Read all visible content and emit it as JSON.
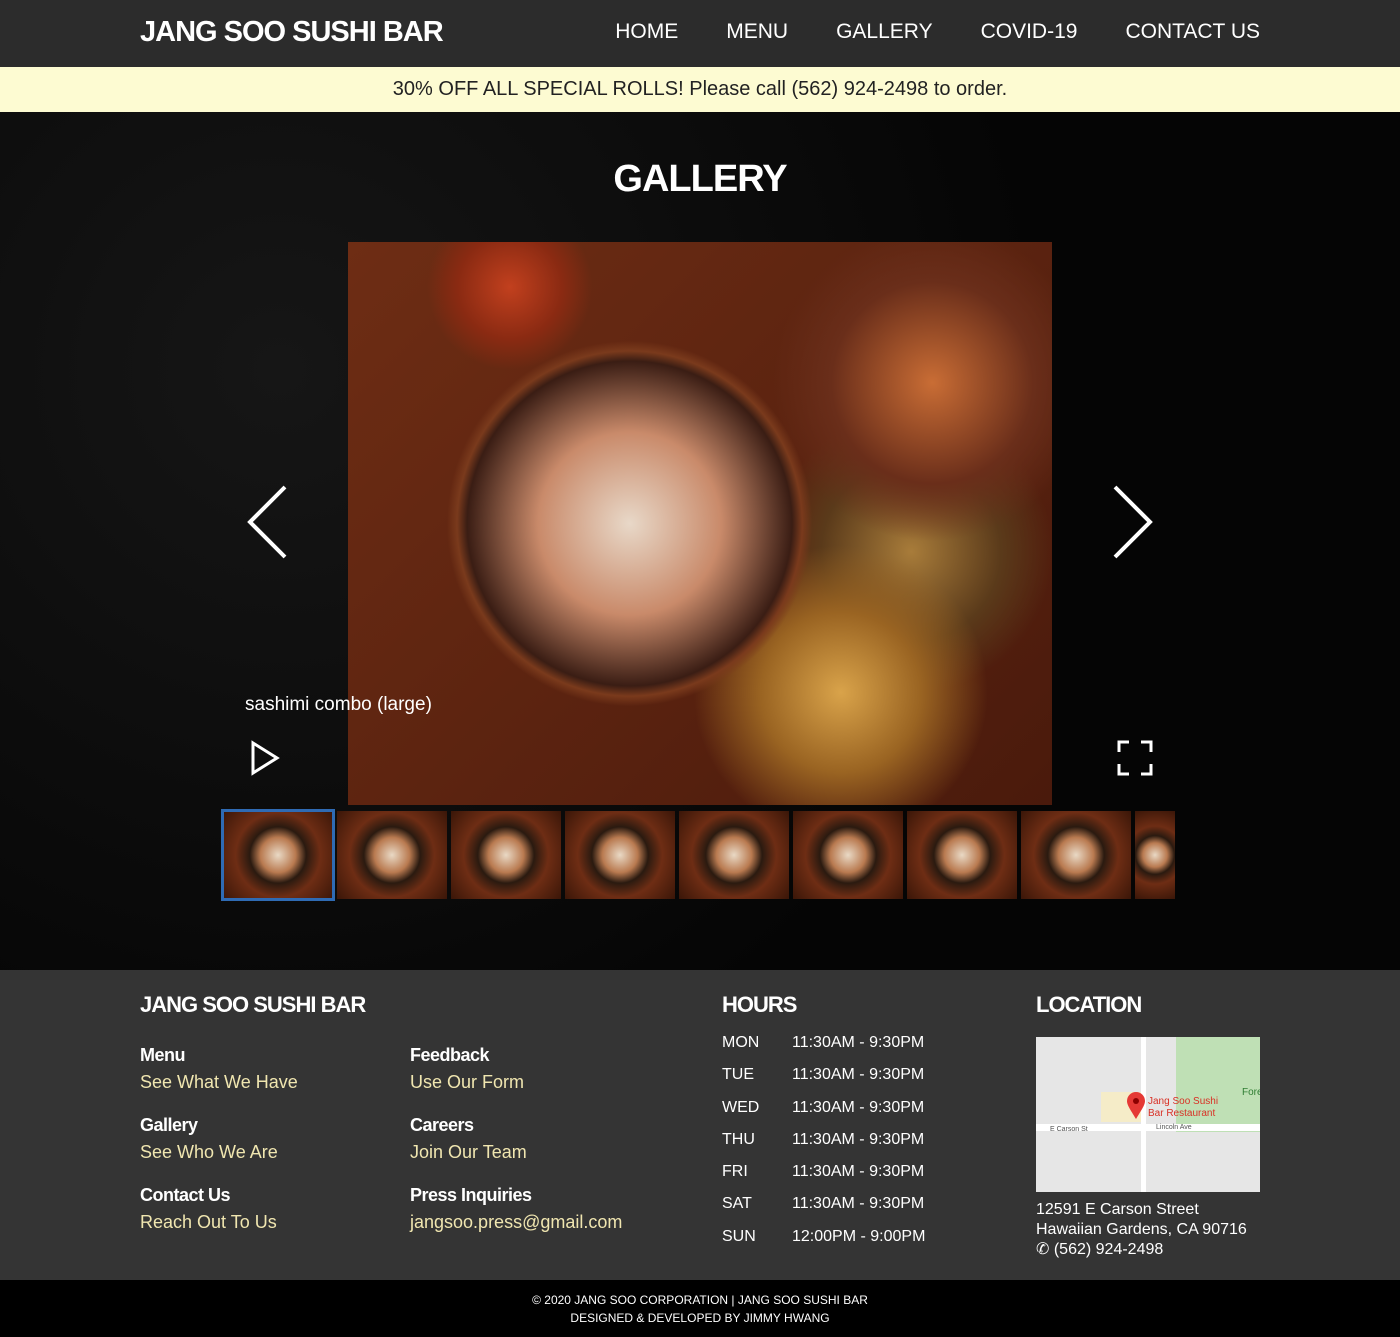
{
  "nav": {
    "logo": "JANG SOO SUSHI BAR",
    "items": [
      "HOME",
      "MENU",
      "GALLERY",
      "COVID-19",
      "CONTACT US"
    ]
  },
  "banner": "30% OFF ALL SPECIAL ROLLS! Please call (562) 924-2498 to order.",
  "gallery": {
    "title": "GALLERY",
    "caption": "sashimi combo (large)",
    "thumb_count": 9,
    "active_index": 0
  },
  "footer": {
    "brand": "JANG SOO SUSHI BAR",
    "links": [
      {
        "title": "Menu",
        "link": "See What We Have"
      },
      {
        "title": "Gallery",
        "link": "See Who We Are"
      },
      {
        "title": "Contact Us",
        "link": "Reach Out To Us"
      },
      {
        "title": "Feedback",
        "link": "Use Our Form"
      },
      {
        "title": "Careers",
        "link": "Join Our Team"
      },
      {
        "title": "Press Inquiries",
        "link": "jangsoo.press@gmail.com"
      }
    ],
    "hours_title": "HOURS",
    "hours": [
      [
        "MON",
        "11:30AM - 9:30PM"
      ],
      [
        "TUE",
        "11:30AM - 9:30PM"
      ],
      [
        "WED",
        "11:30AM - 9:30PM"
      ],
      [
        "THU",
        "11:30AM - 9:30PM"
      ],
      [
        "FRI",
        "11:30AM - 9:30PM"
      ],
      [
        "SAT",
        "11:30AM - 9:30PM"
      ],
      [
        "SUN",
        "12:00PM - 9:00PM"
      ]
    ],
    "location_title": "LOCATION",
    "map": {
      "pin_label_1": "Jang Soo Sushi",
      "pin_label_2": "Bar Restaurant",
      "street_1": "E Carson St",
      "street_2": "Lincoln Ave",
      "park": "Fore"
    },
    "address_1": "12591 E Carson Street",
    "address_2": "Hawaiian Gardens, CA 90716",
    "phone": "✆ (562) 924-2498"
  },
  "bottom": {
    "line1": "© 2020 JANG SOO CORPORATION | JANG SOO SUSHI BAR",
    "line2": "DESIGNED & DEVELOPED BY JIMMY HWANG"
  }
}
